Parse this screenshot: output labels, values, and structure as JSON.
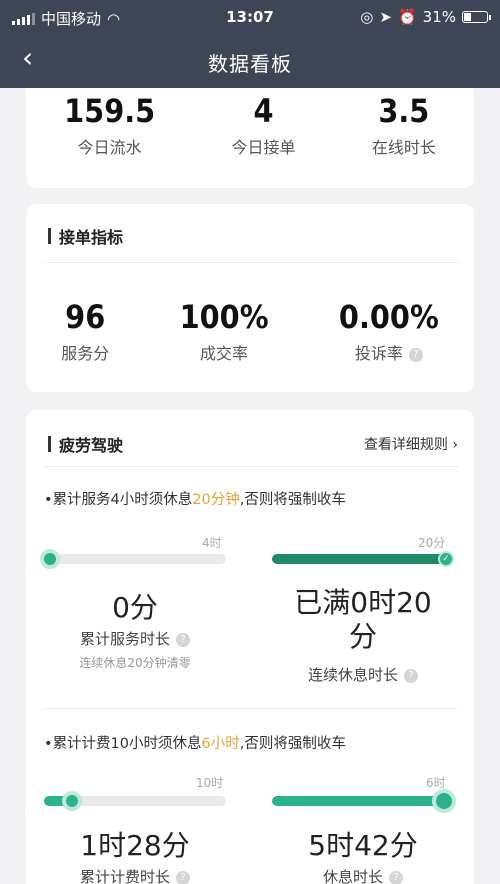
{
  "status_bar": {
    "carrier": "中国移动",
    "time": "13:07",
    "battery": "31%",
    "battery_level": 0.31,
    "icons": [
      "wifi-icon",
      "alarm-icon",
      "location-icon",
      "clock-icon"
    ]
  },
  "nav": {
    "back_icon": "‹",
    "title": "数据看板"
  },
  "today": {
    "items": [
      {
        "value": "159.5",
        "label": "今日流水"
      },
      {
        "value": "4",
        "label": "今日接单"
      },
      {
        "value": "3.5",
        "label": "在线时长"
      }
    ]
  },
  "orders": {
    "title": "接单指标",
    "items": [
      {
        "value": "96",
        "label": "服务分"
      },
      {
        "value": "100%",
        "label": "成交率"
      },
      {
        "value": "0.00%",
        "label": "投诉率"
      }
    ]
  },
  "fatigue": {
    "title": "疲劳驾驶",
    "rules_link": "查看详细规则",
    "rule1": {
      "bullet": "•",
      "pre": "累计服务4小时须休息",
      "hl": "20分钟",
      "post": ",否则将强制收车"
    },
    "left1": {
      "max_label": "4时",
      "progress": 0.0,
      "value": "0分",
      "label": "累计服务时长",
      "sub": "连续休息20分钟清零"
    },
    "right1": {
      "max_label": "20分",
      "progress": 1.0,
      "value_line1": "已满0时20",
      "value_line2": "分",
      "label": "连续休息时长"
    },
    "rule2": {
      "bullet": "•",
      "pre": "累计计费10小时须休息",
      "hl": "6小时",
      "post": ",否则将强制收车"
    },
    "left2": {
      "max_label": "10时",
      "progress": 0.15,
      "value": "1时28分",
      "label": "累计计费时长"
    },
    "right2": {
      "max_label": "6时",
      "progress": 0.95,
      "value": "5时42分",
      "label": "休息时长"
    }
  },
  "colors": {
    "header": "#3e4557",
    "accent": "#2bb28a",
    "highlight": "#e8a23a"
  }
}
